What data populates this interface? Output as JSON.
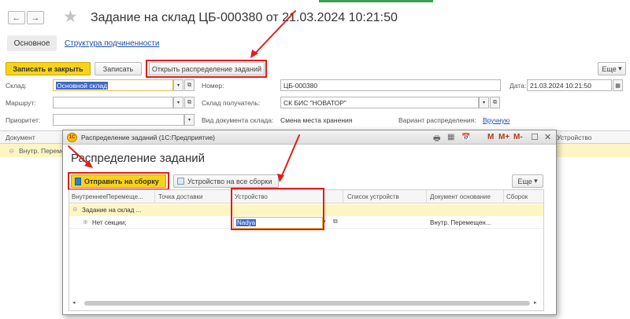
{
  "window": {
    "title": "Задание на склад ЦБ-000380 от 21.03.2024 10:21:50",
    "back_icon": "←",
    "forward_icon": "→",
    "star_icon": "★"
  },
  "tabs": {
    "main": "Основное",
    "structure": "Структура подчиненности"
  },
  "toolbar": {
    "save_close": "Записать и закрыть",
    "save": "Записать",
    "open_distribution": "Открыть распределение заданий",
    "more": "Еще"
  },
  "form": {
    "warehouse_label": "Склад:",
    "warehouse_value": "Основной склад",
    "number_label": "Номер:",
    "number_value": "ЦБ-000380",
    "date_label": "Дата:",
    "date_value": "21.03.2024 10:21:50",
    "route_label": "Маршрут:",
    "route_value": "",
    "receiver_label": "Склад получатель:",
    "receiver_value": "СК БИС \"НОВАТОР\"",
    "priority_label": "Приоритет:",
    "priority_value": "",
    "doctype_label": "Вид документа склада:",
    "doctype_value": "Смена места хранения",
    "variant_label": "Вариант распределения:",
    "variant_value": "Вручную"
  },
  "bg_table": {
    "col_document": "Документ",
    "col_device": "Устройство",
    "row1": "Внутр. Перемещ"
  },
  "modal": {
    "title": "Распределение заданий (1С:Предприятие)",
    "heading": "Распределение заданий",
    "send_button": "Отправить на сборку",
    "device_all_button": "Устройство на все сборки",
    "more": "Еще",
    "title_buttons": [
      "M",
      "M+",
      "M-"
    ],
    "columns": [
      "ВнутреннееПеремеще...",
      "Точка доставки",
      "Устройство",
      "Список устройств",
      "Документ основание",
      "Сборок"
    ],
    "group_row": "Задание на склад ...",
    "sub_row": {
      "name": "Нет секции;",
      "device": "Nadya",
      "doc": "Внутр. Перемещен..."
    }
  },
  "colors": {
    "accent_yellow": "#f8d31a",
    "highlight_red": "#e31b1b",
    "link_blue": "#1a4fa8",
    "group_row_bg": "#fdf6c4",
    "selected_blue": "#3d68c9"
  }
}
